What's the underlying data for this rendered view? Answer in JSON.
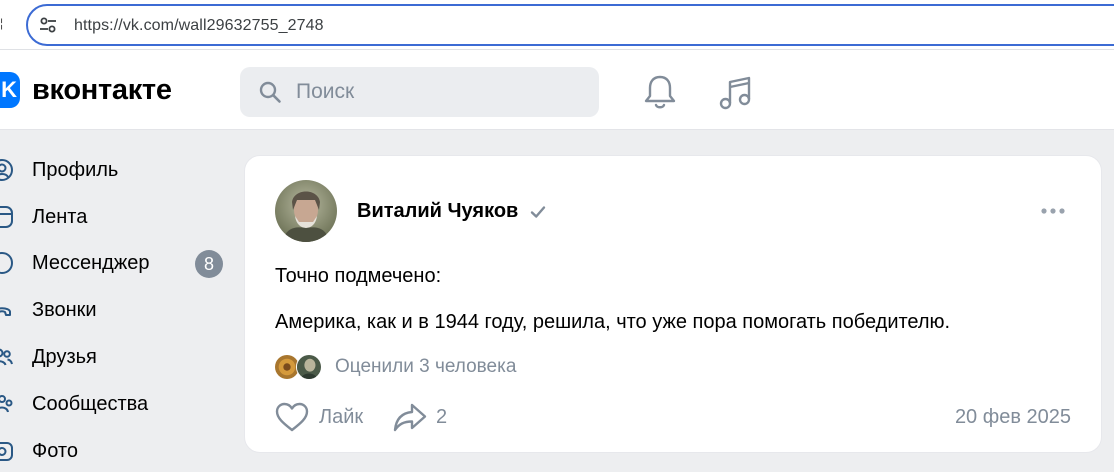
{
  "browser": {
    "url": "https://vk.com/wall29632755_2748"
  },
  "header": {
    "logo_mark": "K",
    "logo_text": "вконтакте",
    "search_placeholder": "Поиск",
    "icons": [
      "bell-icon",
      "music-icon"
    ]
  },
  "sidebar": {
    "items": [
      {
        "label": "Профиль",
        "icon": "profile-icon"
      },
      {
        "label": "Лента",
        "icon": "feed-icon"
      },
      {
        "label": "Мессенджер",
        "icon": "messenger-icon",
        "badge": "8"
      },
      {
        "label": "Звонки",
        "icon": "calls-icon"
      },
      {
        "label": "Друзья",
        "icon": "friends-icon"
      },
      {
        "label": "Сообщества",
        "icon": "communities-icon"
      },
      {
        "label": "Фото",
        "icon": "photo-icon"
      }
    ]
  },
  "post": {
    "author": "Виталий Чуяков",
    "text_line1": "Точно подмечено:",
    "text_line2": "Америка, как и в 1944 году, решила, что уже пора помогать победителю.",
    "rated_text": "Оценили 3 человека",
    "like_label": "Лайк",
    "share_count": "2",
    "date": "20 фев 2025"
  },
  "colors": {
    "brand": "#0077ff",
    "secondary_text": "#818c99",
    "page_background": "#edeef0",
    "address_border": "#3c6bd4"
  }
}
